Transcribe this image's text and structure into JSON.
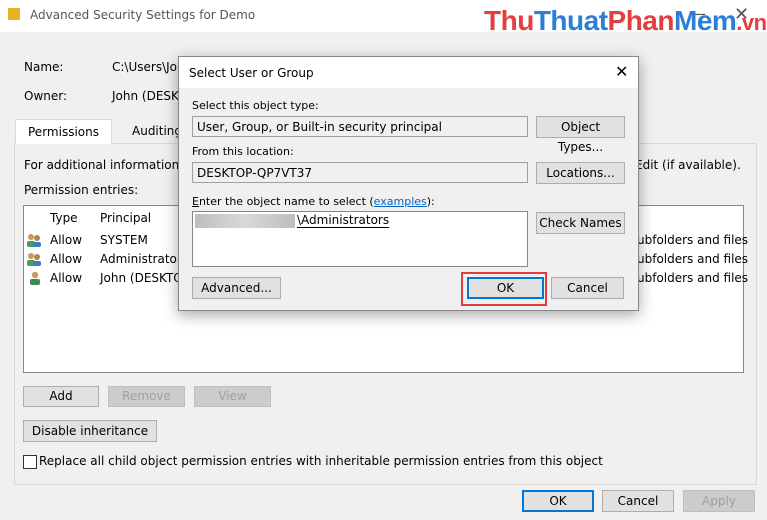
{
  "window": {
    "title": "Advanced Security Settings for Demo",
    "minimize_glyph": "—",
    "close_glyph": "✕"
  },
  "watermark": {
    "part1": "Thu",
    "part2": "Thuat",
    "part3": "Phan",
    "part4": "Mem",
    "part5": ".vn"
  },
  "details": {
    "name_label": "Name:",
    "name_value": "C:\\Users\\John",
    "owner_label": "Owner:",
    "owner_value": "John (DESKTOP"
  },
  "tabs": [
    {
      "label": "Permissions"
    },
    {
      "label": "Auditing"
    }
  ],
  "info_text_left": "For additional information, do",
  "info_text_right": "Edit (if available).",
  "permission_entries_label": "Permission entries:",
  "table": {
    "headers": [
      "Type",
      "Principal"
    ],
    "rows": [
      {
        "type": "Allow",
        "principal": "SYSTEM",
        "applies_to": "ubfolders and files"
      },
      {
        "type": "Allow",
        "principal": "Administrators",
        "applies_to": "ubfolders and files"
      },
      {
        "type": "Allow",
        "principal": "John (DESKTOP",
        "applies_to": "ubfolders and files"
      }
    ]
  },
  "buttons": {
    "add": "Add",
    "remove": "Remove",
    "view": "View",
    "disable_inheritance": "Disable inheritance",
    "ok": "OK",
    "cancel": "Cancel",
    "apply": "Apply"
  },
  "replace_checkbox_label": "Replace all child object permission entries with inheritable permission entries from this object",
  "dialog": {
    "title": "Select User or Group",
    "object_type_label": "Select this object type:",
    "object_type_value": "User, Group, or Built-in security principal",
    "object_types_button": "Object Types...",
    "location_label": "From this location:",
    "location_value": "DESKTOP-QP7VT37",
    "locations_button": "Locations...",
    "enter_name_label_prefix": "nter the object name to select (",
    "enter_name_label_first": "E",
    "enter_name_link": "examples",
    "enter_name_label_suffix": "):",
    "entered_value": "\\Administrators",
    "check_names_button": "Check Names",
    "advanced_button": "Advanced...",
    "ok_button": "OK",
    "cancel_button": "Cancel"
  },
  "colors": {
    "highlight": "#e03c3c",
    "link": "#0066cc",
    "default_button_border": "#0078d7"
  }
}
